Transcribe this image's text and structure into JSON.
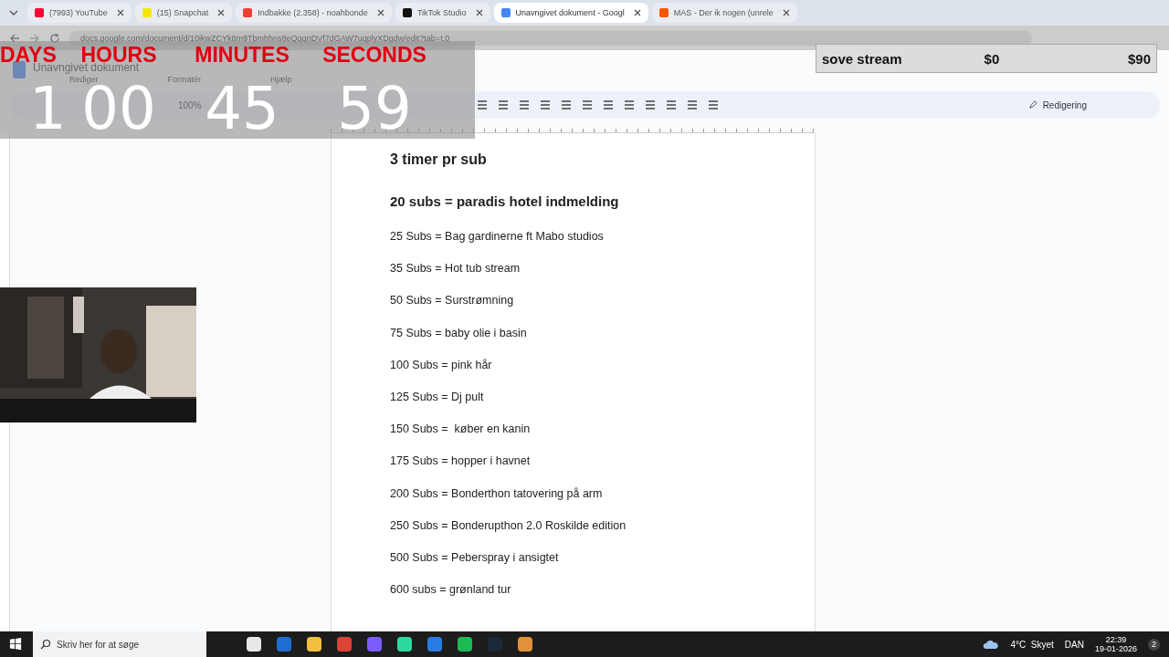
{
  "browser": {
    "tabs": [
      {
        "title": "(7993) YouTube",
        "selected": false,
        "color": "#ff0033"
      },
      {
        "title": "(15) Snapchat",
        "selected": false,
        "color": "#f7e600"
      },
      {
        "title": "Indbakke (2.358) - noahbonde",
        "selected": false,
        "color": "#ea4335"
      },
      {
        "title": "TikTok Studio",
        "selected": false,
        "color": "#111111"
      },
      {
        "title": "Unavngivet dokument - Googl",
        "selected": true,
        "color": "#4285f4"
      },
      {
        "title": "MAS - Der ik nogen (unrele",
        "selected": false,
        "color": "#ff5500"
      }
    ],
    "url": "docs.google.com/document/d/10ikwZCYk8m9Tbmhhns8eQqqnDVf7dGAW7uqplyXDgdw/edit?tab=t.0"
  },
  "countdown": [
    {
      "label": "DAYS",
      "value": "1"
    },
    {
      "label": "HOURS",
      "value": "00"
    },
    {
      "label": "MINUTES",
      "value": "45"
    },
    {
      "label": "SECONDS",
      "value": "59"
    }
  ],
  "goal": {
    "title": "sove stream",
    "current": "$0",
    "target": "$90"
  },
  "document": {
    "title": "Unavngivet dokument",
    "menus": [
      "Rediger",
      "Formatér",
      "Hjælp"
    ],
    "zoom": "100%",
    "mode": "Redigering",
    "lines": [
      {
        "kind": "heading",
        "text": "3 timer pr sub"
      },
      {
        "kind": "subheading",
        "text": "20 subs = paradis hotel indmelding"
      },
      {
        "kind": "item",
        "text": "25 Subs = Bag gardinerne ft Mabo studios"
      },
      {
        "kind": "item",
        "text": "35 Subs = Hot tub stream"
      },
      {
        "kind": "item",
        "text": "50 Subs = Surstrømning"
      },
      {
        "kind": "item",
        "text": "75 Subs = baby olie i basin"
      },
      {
        "kind": "item",
        "text": "100 Subs = pink hår"
      },
      {
        "kind": "item",
        "text": "125 Subs = Dj pult"
      },
      {
        "kind": "item",
        "text": "150 Subs =  køber en kanin"
      },
      {
        "kind": "item",
        "text": "175 Subs = hopper i havnet"
      },
      {
        "kind": "item",
        "text": "200 Subs = Bonderthon tatovering på arm"
      },
      {
        "kind": "item",
        "text": "250 Subs = Bonderupthon 2.0 Roskilde edition"
      },
      {
        "kind": "item",
        "text": "500 Subs = Peberspray i ansigtet"
      },
      {
        "kind": "item",
        "text": "600 subs = grønland tur"
      }
    ]
  },
  "taskbar": {
    "search": {
      "placeholder": "Skriv her for at søge"
    },
    "apps": [
      {
        "color": "#e8e8e8"
      },
      {
        "color": "#1f6fd1"
      },
      {
        "color": "#f2c040"
      },
      {
        "color": "#db4437"
      },
      {
        "color": "#7c5cff"
      },
      {
        "color": "#2fd7a0"
      },
      {
        "color": "#2a7be4"
      },
      {
        "color": "#1db954"
      },
      {
        "color": "#1b2838"
      },
      {
        "color": "#e0913a"
      }
    ],
    "weather": "4°C  Skyet",
    "language": "DAN",
    "time": "22:39",
    "date": "19-01-2026",
    "notifications": "2"
  }
}
